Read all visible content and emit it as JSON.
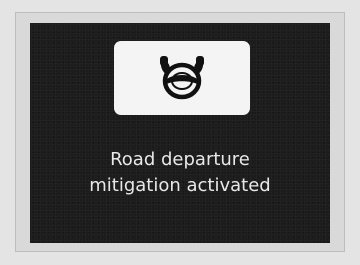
{
  "display": {
    "icon": "steering-wheel-icon",
    "message_line1": "Road departure",
    "message_line2": "mitigation activated",
    "colors": {
      "screen_background": "#1c1c1c",
      "icon_box": "#f4f4f4",
      "text": "#e8e8e8"
    }
  }
}
